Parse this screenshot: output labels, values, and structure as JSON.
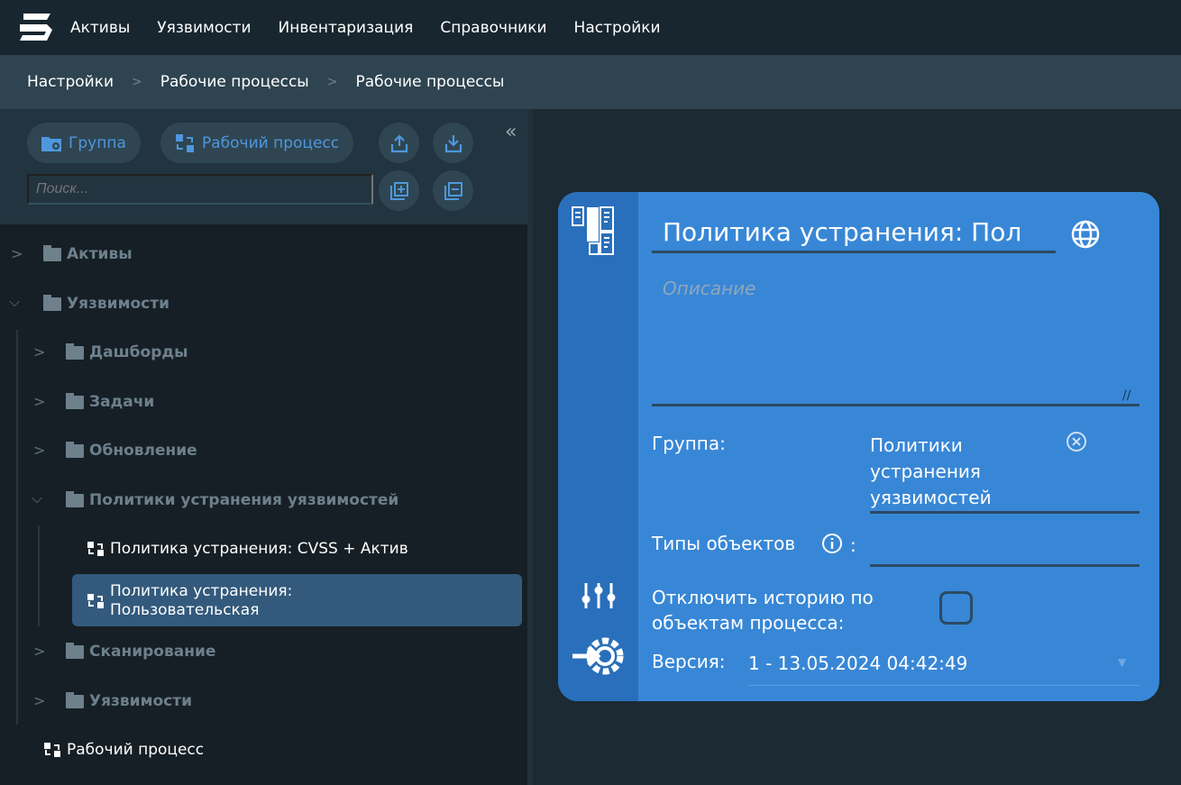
{
  "topbar": {
    "nav": [
      "Активы",
      "Уязвимости",
      "Инвентаризация",
      "Справочники",
      "Настройки"
    ]
  },
  "breadcrumb": [
    "Настройки",
    "Рабочие процессы",
    "Рабочие процессы"
  ],
  "sidebar": {
    "group_button": "Группа",
    "workflow_button": "Рабочий процесс",
    "search_placeholder": "Поиск...",
    "collapse": "«"
  },
  "tree": {
    "assets": "Активы",
    "vulns": "Уязвимости",
    "dashboards": "Дашборды",
    "tasks": "Задачи",
    "update": "Обновление",
    "policies": "Политики устранения уязвимостей",
    "policy1": "Политика устранения: CVSS + Актив",
    "policy2_line1": "Политика устранения:",
    "policy2_line2": "Пользовательская",
    "scanning": "Сканирование",
    "vulns2": "Уязвимости",
    "workflow": "Рабочий процесс"
  },
  "card": {
    "title": "Политика устранения: Пол",
    "description_placeholder": "Описание",
    "group_label": "Группа:",
    "group_value": [
      "Политики",
      "устранения",
      "уязвимостей"
    ],
    "object_types_label": "Типы объектов",
    "colon": ":",
    "history_label": [
      "Отключить историю по",
      "объектам процесса:"
    ],
    "history_checked": false,
    "version_label": "Версия:",
    "version_value": "1 - 13.05.2024 04:42:49"
  },
  "colors": {
    "card": "#3887d6",
    "strip": "#2a6fbb",
    "selected": "#335a7c"
  }
}
